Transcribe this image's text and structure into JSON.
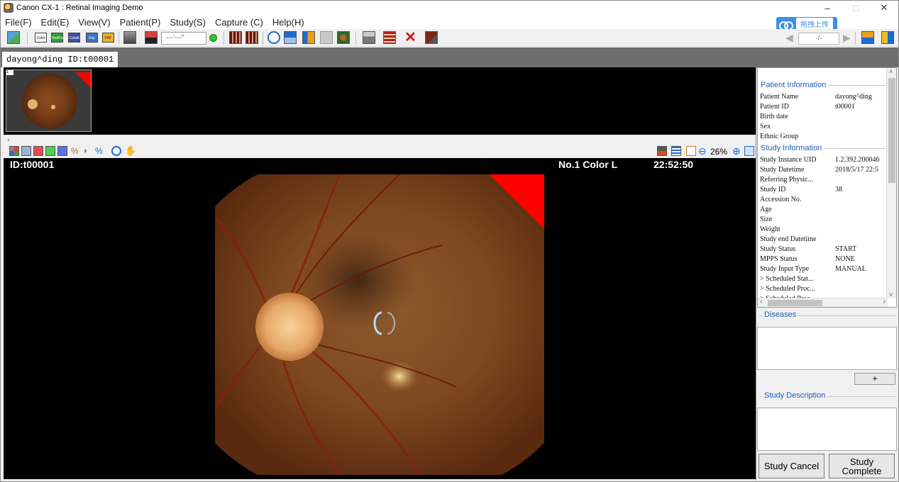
{
  "window": {
    "title": "Canon CX-1 : Retinal Imaging Demo",
    "minimize": "–",
    "maximize": "□",
    "close": "✕"
  },
  "menu": [
    "File(F)",
    "Edit(E)",
    "View(V)",
    "Patient(P)",
    "Study(S)",
    "Capture (C)",
    "Help(H)"
  ],
  "upload_badge": "拖拽上传",
  "toolbar": {
    "mode_buttons": [
      "Color",
      "RedFree",
      "Cobalt",
      "Exp",
      "FAF"
    ],
    "exposure_field": "---'---\"",
    "nav_field": "-/-"
  },
  "tab": {
    "label": "dayong^ding ID:t00001"
  },
  "thumbnail": {
    "number": "1"
  },
  "viewer": {
    "patient_id": "ID:t00001",
    "image_label": "No.1 Color L",
    "time": "22:52:50",
    "zoom": "26%"
  },
  "patient_info": {
    "header": "Patient Information",
    "rows": [
      {
        "label": "Patient Name",
        "value": "dayong^ding"
      },
      {
        "label": "Patient ID",
        "value": "t00001"
      },
      {
        "label": "Birth date",
        "value": ""
      },
      {
        "label": "Sex",
        "value": ""
      },
      {
        "label": "Ethnic Group",
        "value": ""
      }
    ]
  },
  "study_info": {
    "header": "Study Information",
    "rows": [
      {
        "label": "Study Instance UID",
        "value": "1.2.392.200046"
      },
      {
        "label": "Study Datetime",
        "value": "2018/5/17 22:5"
      },
      {
        "label": "Referring Physic...",
        "value": ""
      },
      {
        "label": "Study ID",
        "value": "38"
      },
      {
        "label": "Accession No.",
        "value": ""
      },
      {
        "label": "Age",
        "value": ""
      },
      {
        "label": "Size",
        "value": ""
      },
      {
        "label": "Weight",
        "value": ""
      },
      {
        "label": "Study end Datetime",
        "value": ""
      },
      {
        "label": "Study Status",
        "value": "START"
      },
      {
        "label": "MPPS Status",
        "value": "NONE"
      },
      {
        "label": "Study Input Type",
        "value": "MANUAL"
      },
      {
        "label": "> Scheduled Stat...",
        "value": ""
      },
      {
        "label": "> Scheduled Proc...",
        "value": ""
      },
      {
        "label": "> Scheduled Proc...",
        "value": ""
      }
    ]
  },
  "diseases": {
    "header": "Diseases",
    "add_label": "+"
  },
  "study_description": {
    "header": "Study Description"
  },
  "buttons": {
    "cancel": "Study Cancel",
    "complete_line1": "Study",
    "complete_line2": "Complete"
  },
  "colors": {
    "marker_red": "#ff0000",
    "header_blue": "#1f5fb5",
    "tab_bg": "#6e6e6e"
  }
}
